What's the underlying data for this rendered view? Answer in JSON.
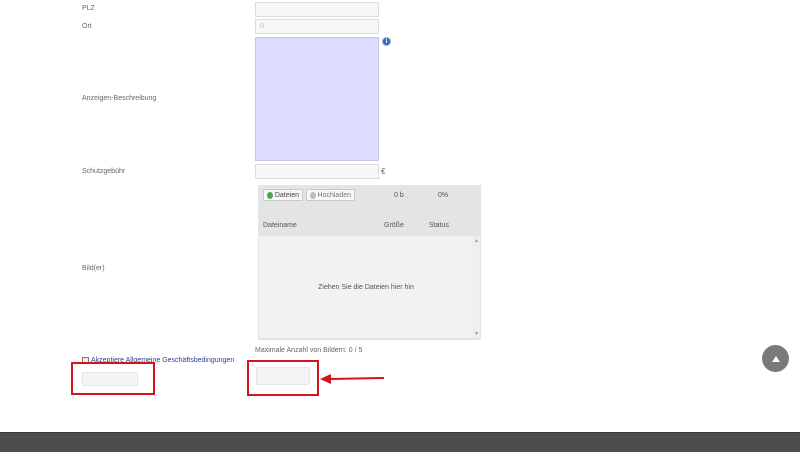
{
  "form": {
    "plz_label": "PLZ",
    "ort_label": "Ort",
    "ort_value": "0",
    "description_label": "Anzeigen-Beschreibung",
    "fee_label": "Schutzgebühr",
    "fee_unit": "€",
    "images_label": "Bild(er)",
    "info_icon_glyph": "i"
  },
  "uploader": {
    "files_button": "Dateien",
    "upload_button": "Hochladen",
    "total_size": "0 b",
    "progress_percent": "0%",
    "columns": {
      "filename": "Dateiname",
      "size": "Größe",
      "status": "Status"
    },
    "drop_hint": "Ziehen Sie die Dateien hier hin",
    "max_images": "Maximale Anzahl von Bildern: 0 / 5"
  },
  "terms": {
    "label": "Akzeptiere Allgemeine Geschäftsbedingungen"
  },
  "colors": {
    "annotation_red": "#d4141c",
    "textarea_bg": "#dcdcff",
    "footer_bg": "#4d4d4d"
  }
}
